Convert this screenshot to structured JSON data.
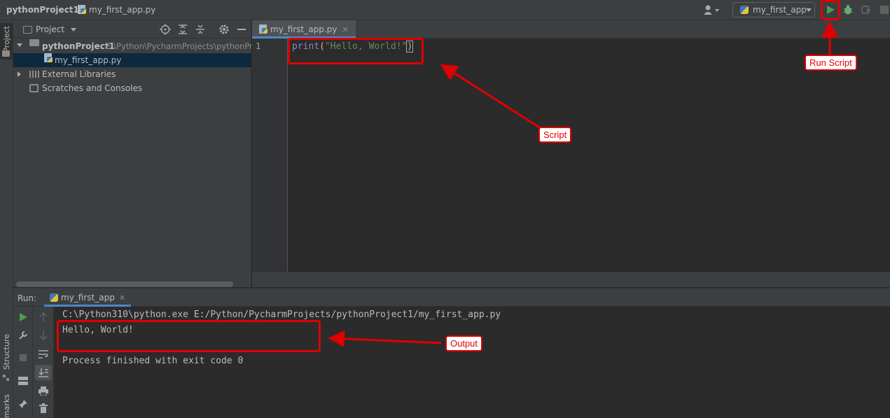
{
  "titlebar": {
    "project_name": "pythonProject1",
    "file_name": "my_first_app.py",
    "run_config": "my_first_app"
  },
  "left_stripe": {
    "project_label": "Project",
    "structure_label": "Structure",
    "bookmarks_label": "marks"
  },
  "project_panel": {
    "header_label": "Project",
    "tree": [
      {
        "label": "pythonProject1",
        "path": "E:\\Python\\PycharmProjects\\pythonPro"
      },
      {
        "label": "my_first_app.py"
      },
      {
        "label": "External Libraries"
      },
      {
        "label": "Scratches and Consoles"
      }
    ]
  },
  "editor": {
    "tab_label": "my_first_app.py",
    "line_number": "1",
    "code": {
      "fn": "print",
      "open": "(",
      "string": "\"Hello, World!\"",
      "close": ")"
    }
  },
  "run_panel": {
    "run_label": "Run:",
    "tab_label": "my_first_app",
    "console_lines": [
      "C:\\Python310\\python.exe E:/Python/PycharmProjects/pythonProject1/my_first_app.py",
      "Hello, World!",
      "Process finished with exit code 0"
    ]
  },
  "annotations": {
    "run_script": "Run Script",
    "script": "Script",
    "output": "Output"
  },
  "colors": {
    "annotation_red": "#e00000",
    "run_green": "#499c54",
    "debug_green": "#6aab73",
    "selection": "#0d293e"
  }
}
